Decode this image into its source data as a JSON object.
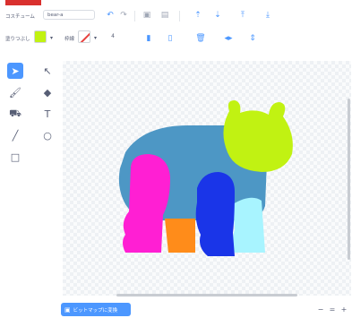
{
  "header": {
    "costume_label": "コスチューム",
    "costume_name": "bear-a"
  },
  "toolbar": {
    "fill_label": "塗りつぶし",
    "outline_label": "枠線",
    "outline_width": "4"
  },
  "colors": {
    "accent": "#4c97ff",
    "fill": "#c1f212",
    "outline": "#e7403d",
    "bear_body": "#4d97c5",
    "bear_head": "#c1f212",
    "leg_magenta": "#ff1fd3",
    "leg_orange": "#ff8c1a",
    "leg_blue": "#1a35e8",
    "leg_cyan": "#a8f4ff"
  },
  "canvas": {
    "convert_label": "ビットマップに変換"
  }
}
